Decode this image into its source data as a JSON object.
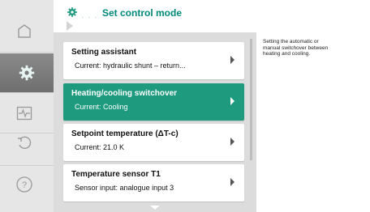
{
  "header": {
    "title": "Set control mode",
    "icon": "gear-icon"
  },
  "nav": [
    {
      "name": "home-icon",
      "active": false
    },
    {
      "name": "gear-icon",
      "active": true
    },
    {
      "name": "diagnostics-icon",
      "active": false
    },
    {
      "name": "back-icon",
      "active": false
    },
    {
      "name": "help-icon",
      "active": false
    }
  ],
  "menu": [
    {
      "title": "Setting assistant",
      "subtitle": "Current: hydraulic shunt – return...",
      "selected": false
    },
    {
      "title": "Heating/cooling switchover",
      "subtitle": "Current: Cooling",
      "selected": true
    },
    {
      "title": "Setpoint temperature (ΔT-c)",
      "subtitle": "Current: 21.0 K",
      "selected": false
    },
    {
      "title": "Temperature sensor T1",
      "subtitle": "Sensor input: analogue input 3",
      "selected": false
    }
  ],
  "info": {
    "text": "Setting the automatic or manual switchover between heating and cooling."
  },
  "colors": {
    "accent": "#00897a",
    "selected": "#1e9a7e",
    "rail": "#e6e6e6",
    "list_bg": "#dcdcdc"
  }
}
